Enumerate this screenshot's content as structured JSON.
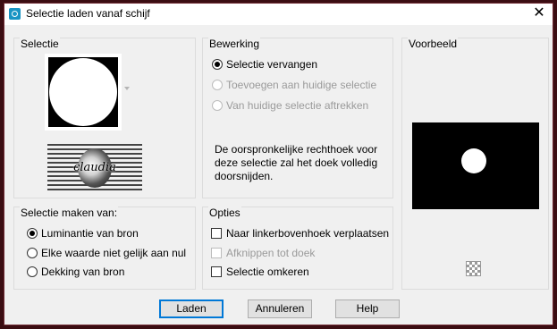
{
  "window": {
    "title": "Selectie laden vanaf schijf",
    "close_glyph": "✕"
  },
  "selectie": {
    "label": "Selectie",
    "watermark_text": "claudia"
  },
  "bewerking": {
    "label": "Bewerking",
    "options": [
      "Selectie vervangen",
      "Toevoegen aan huidige selectie",
      "Van huidige selectie aftrekken"
    ],
    "description": "De oorspronkelijke rechthoek voor deze selectie zal het doek volledig doorsnijden."
  },
  "voorbeeld": {
    "label": "Voorbeeld"
  },
  "maken": {
    "label": "Selectie maken van:",
    "options": [
      "Luminantie van bron",
      "Elke waarde niet gelijk aan nul",
      "Dekking van bron"
    ]
  },
  "opties": {
    "label": "Opties",
    "items": [
      "Naar linkerbovenhoek verplaatsen",
      "Afknippen tot doek",
      "Selectie omkeren"
    ]
  },
  "buttons": {
    "load": "Laden",
    "cancel": "Annuleren",
    "help": "Help"
  },
  "colors": {
    "accent": "#0078d7",
    "frame": "#3b0d12",
    "icon": "#1a95c4"
  }
}
